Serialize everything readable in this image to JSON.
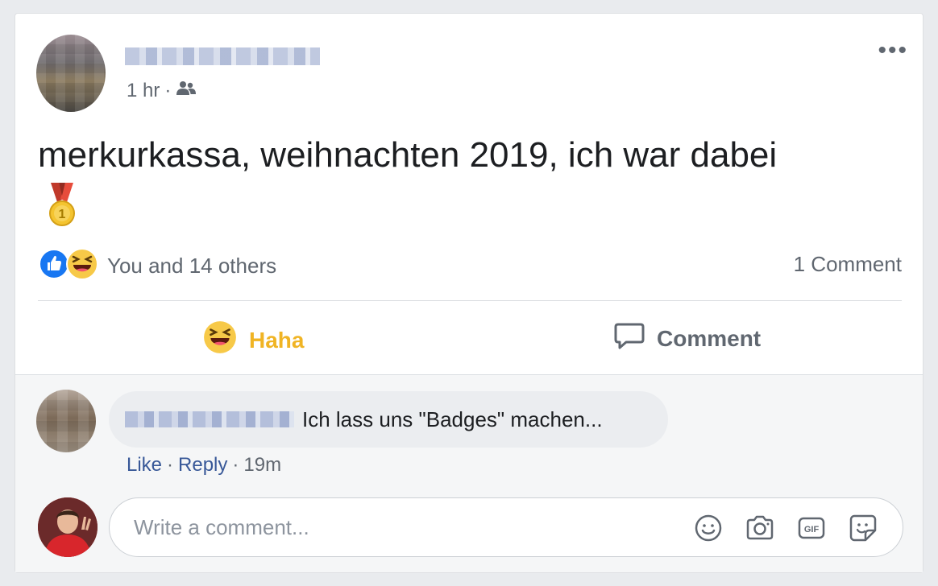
{
  "post": {
    "time": "1 hr",
    "separator": "·",
    "audience_icon": "friends-icon",
    "more_label": "•••",
    "text": "merkurkassa, weihnachten 2019, ich war dabei",
    "emoji_icon": "first-place-medal-icon"
  },
  "reactions": {
    "icons": [
      "like-icon",
      "haha-icon"
    ],
    "summary": "You and 14 others",
    "comment_count": "1 Comment"
  },
  "actions": {
    "haha_label": "Haha",
    "comment_label": "Comment"
  },
  "comment": {
    "text": "Ich lass uns \"Badges\" machen...",
    "like_label": "Like",
    "reply_label": "Reply",
    "separator": "·",
    "time": "19m"
  },
  "composer": {
    "placeholder": "Write a comment...",
    "icons": [
      "emoji-icon",
      "camera-icon",
      "gif-icon",
      "sticker-icon"
    ]
  },
  "colors": {
    "haha": "#f0b424",
    "link": "#385898",
    "like_blue": "#1877f2",
    "muted": "#606770"
  }
}
